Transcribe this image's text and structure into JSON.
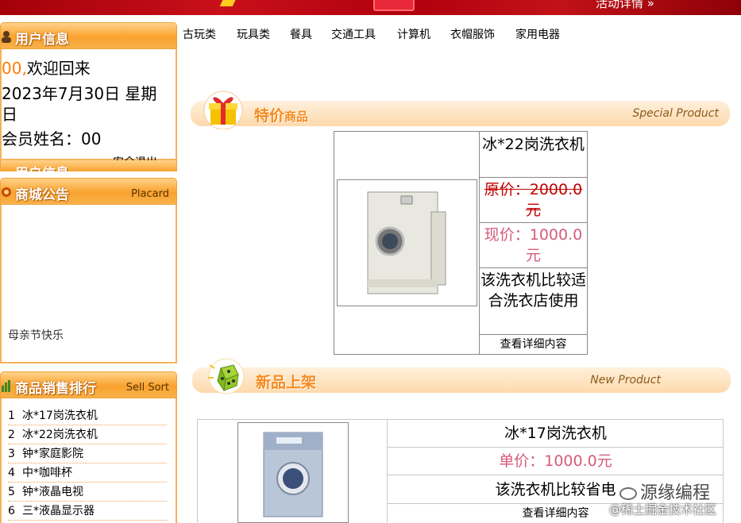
{
  "banner": {
    "more_label": "活动详情 »"
  },
  "user_panel": {
    "title": "用户信息",
    "greeting_name": "00,",
    "greeting_text": "欢迎回来",
    "date_line1": "2023年7月30日 星期",
    "date_line2": "日",
    "member_label": "会员姓名：00",
    "logout": "安全退出",
    "ghost_title": "用户信息"
  },
  "notice_panel": {
    "title": "商城公告",
    "en": "Placard",
    "items": [
      "母亲节快乐"
    ]
  },
  "rank_panel": {
    "title": "商品销售排行",
    "en": "Sell Sort",
    "items": [
      {
        "rank": "1",
        "name": "冰*17岗洗衣机"
      },
      {
        "rank": "2",
        "name": "冰*22岗洗衣机"
      },
      {
        "rank": "3",
        "name": "钟*家庭影院"
      },
      {
        "rank": "4",
        "name": "中*咖啡杯"
      },
      {
        "rank": "5",
        "name": "钟*液晶电视"
      },
      {
        "rank": "6",
        "name": "三*液晶显示器"
      }
    ]
  },
  "nav": [
    "古玩类",
    "玩具类",
    "餐具",
    "交通工具",
    "计算机",
    "衣帽服饰",
    "家用电器"
  ],
  "special": {
    "title_main": "特价",
    "title_sub": "商品",
    "en": "Special Product",
    "product_name": "冰*22岗洗衣机",
    "original_price": "原价：2000.0元",
    "current_price": "现价：1000.0元",
    "description": "该洗衣机比较适合洗衣店使用",
    "detail_link": "查看详细内容"
  },
  "new_products": {
    "title": "新品上架",
    "en": "New Product",
    "product_name": "冰*17岗洗衣机",
    "price": "单价：1000.0元",
    "description": "该洗衣机比较省电",
    "detail_link": "查看详细内容"
  },
  "watermark": {
    "line1": "源缘编程",
    "line2": "@稀土掘金技术社区"
  },
  "colors": {
    "accent_orange": "#f9a22e",
    "price_pink": "#d65b7c",
    "strike_red": "#c00000",
    "banner_red": "#b0000e"
  }
}
